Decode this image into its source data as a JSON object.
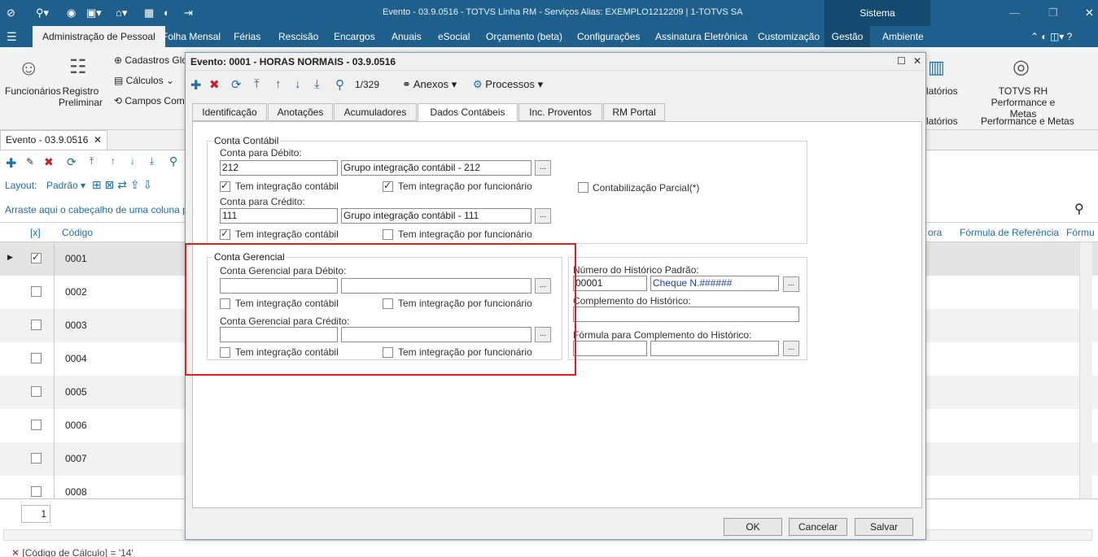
{
  "app": {
    "title": "Evento - 03.9.0516 - TOTVS Linha RM - Serviços  Alias: EXEMPLO1212209  |  1-TOTVS SA",
    "sistema": "Sistema"
  },
  "menu": [
    "Administração de Pessoal",
    "Folha Mensal",
    "Férias",
    "Rescisão",
    "Encargos",
    "Anuais",
    "eSocial",
    "Orçamento (beta)",
    "Configurações",
    "Assinatura Eletrônica",
    "Customização",
    "Gestão",
    "Ambiente"
  ],
  "ribbon": {
    "funcionarios": "Funcionários",
    "registro": "Registro Preliminar",
    "cadastros": "Cadastros Glo",
    "calculos": "Cálculos",
    "campos": "Campos Comp",
    "relatorios": "latórios",
    "relatorios2": "latórios",
    "totvs_rh": "TOTVS RH Performance e Metas",
    "totvs_rh2": "Performance e Metas"
  },
  "bg": {
    "tab": "Evento - 03.9.0516",
    "layout_label": "Layout:",
    "layout_value": "Padrão",
    "drag_hint": "Arraste aqui o cabeçalho de uma coluna para",
    "col_x": "[x]",
    "col_codigo": "Código",
    "col_hora": "ora",
    "col_formula": "Fórmula de Referência",
    "col_form2": "Fórmu",
    "rows": [
      "0001",
      "0002",
      "0003",
      "0004",
      "0005",
      "0006",
      "0007",
      "0008"
    ],
    "page": "1",
    "filter": "[Código de Cálculo] = '14'"
  },
  "dialog": {
    "title": "Evento: 0001 - HORAS NORMAIS - 03.9.0516",
    "nav": "1/329",
    "anexos": "Anexos",
    "processos": "Processos",
    "tabs": [
      "Identificação",
      "Anotações",
      "Acumuladores",
      "Dados Contábeis",
      "Inc. Proventos",
      "RM Portal"
    ],
    "conta_contabil": {
      "title": "Conta Contábil",
      "debito_label": "Conta para Débito:",
      "debito_code": "212",
      "debito_desc": "Grupo integração contábil - 212",
      "credito_label": "Conta para Crédito:",
      "credito_code": "111",
      "credito_desc": "Grupo integração contábil - 111",
      "integ_contabil": "Tem integração contábil",
      "integ_func": "Tem integração por funcionário",
      "parcial": "Contabilização Parcial(*)"
    },
    "conta_gerencial": {
      "title": "Conta Gerencial",
      "debito_label": "Conta Gerencial para Débito:",
      "credito_label": "Conta Gerencial para Crédito:",
      "integ_contabil": "Tem integração contábil",
      "integ_func": "Tem integração por funcionário"
    },
    "historico": {
      "numero_label": "Número do Histórico Padrão:",
      "numero_code": "00001",
      "numero_desc": "Cheque N.######",
      "complemento_label": "Complemento do Histórico:",
      "formula_label": "Fórmula para Complemento do Histórico:"
    },
    "buttons": {
      "ok": "OK",
      "cancel": "Cancelar",
      "save": "Salvar"
    }
  },
  "colors": {
    "titlebar": "#1f5f8b",
    "highlight": "#e02020",
    "accent": "#1d6fa5"
  }
}
